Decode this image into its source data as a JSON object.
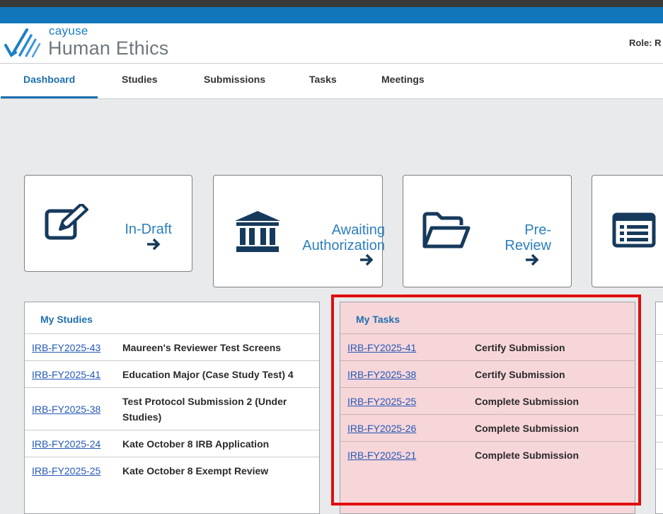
{
  "header": {
    "brand": "cayuse",
    "product": "Human Ethics",
    "role_label": "Role: R"
  },
  "nav": {
    "tabs": [
      {
        "label": "Dashboard",
        "active": true
      },
      {
        "label": "Studies",
        "active": false
      },
      {
        "label": "Submissions",
        "active": false
      },
      {
        "label": "Tasks",
        "active": false
      },
      {
        "label": "Meetings",
        "active": false
      }
    ]
  },
  "cards": [
    {
      "label_line1": "In-Draft",
      "label_line2": "",
      "icon": "edit-icon"
    },
    {
      "label_line1": "Awaiting",
      "label_line2": "Authorization",
      "icon": "institution-icon"
    },
    {
      "label_line1": "Pre-",
      "label_line2": "Review",
      "icon": "folder-icon"
    },
    {
      "label_line1": "",
      "label_line2": "",
      "icon": "list-icon"
    }
  ],
  "my_studies": {
    "title": "My Studies",
    "rows": [
      {
        "id": "IRB-FY2025-43",
        "name": "Maureen's Reviewer Test Screens",
        "name_line2": ""
      },
      {
        "id": "IRB-FY2025-41",
        "name": "Education Major (Case Study Test) 4",
        "name_line2": ""
      },
      {
        "id": "IRB-FY2025-38",
        "name": "Test Protocol Submission 2 (Under",
        "name_line2": "Studies)"
      },
      {
        "id": "IRB-FY2025-24",
        "name": "Kate October 8 IRB Application",
        "name_line2": ""
      },
      {
        "id": "IRB-FY2025-25",
        "name": "Kate October 8 Exempt Review",
        "name_line2": ""
      }
    ]
  },
  "my_tasks": {
    "title": "My Tasks",
    "rows": [
      {
        "id": "IRB-FY2025-41",
        "task": "Certify Submission"
      },
      {
        "id": "IRB-FY2025-38",
        "task": "Certify Submission"
      },
      {
        "id": "IRB-FY2025-25",
        "task": "Complete Submission"
      },
      {
        "id": "IRB-FY2025-26",
        "task": "Complete Submission"
      },
      {
        "id": "IRB-FY2025-21",
        "task": "Complete Submission"
      }
    ]
  },
  "colors": {
    "accent": "#1177bb",
    "link": "#2458b8",
    "highlight": "#e10d0d",
    "tasks_bg": "#f7d6d9"
  }
}
